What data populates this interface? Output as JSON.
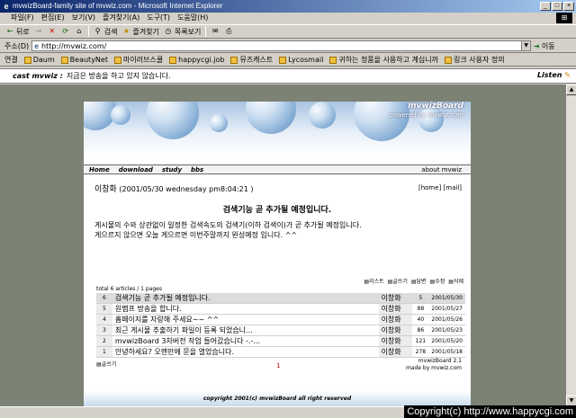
{
  "window": {
    "title": "mvwizBoard-family site of mvwiz.com - Microsoft Internet Explorer",
    "buttons": [
      "_",
      "□",
      "×"
    ]
  },
  "menu": {
    "items": [
      "파일(F)",
      "편집(E)",
      "보기(V)",
      "즐겨찾기(A)",
      "도구(T)",
      "도움말(H)"
    ]
  },
  "toolbar": {
    "back": "뒤로",
    "forward": "→",
    "stop": "✕",
    "refresh": "⟳",
    "home": "⌂",
    "search": "검색",
    "favorites": "즐겨찾기",
    "history": "목록보기",
    "mail": "✉",
    "print": "⎙"
  },
  "address": {
    "label": "주소(D)",
    "value": "http://mvwiz.com/",
    "go": "이동"
  },
  "links": {
    "label": "연결",
    "items": [
      "Daum",
      "BeautyNet",
      "마이러브스쿨",
      "happycgi.job",
      "뮤즈캐스트",
      "Lycosmail",
      "귀하는 정품을 사용하고 계십니까",
      "링크 사용자 정의"
    ]
  },
  "cast": {
    "title": "cast mvwiz :",
    "message": "지금은 방송을 하고 있지 않습니다.",
    "listen": "Listen"
  },
  "banner": {
    "title": "mvwizBoard",
    "subtitle": "powered by mvwiz.com"
  },
  "nav": {
    "items": [
      "Home",
      "download",
      "study",
      "bbs"
    ],
    "about": "about mvwiz"
  },
  "post": {
    "author": "이창화",
    "date": "(2001/05/30 wednesday pm8:04:21 )",
    "home_link": "[home]",
    "mail_link": "[mail]",
    "title": "검색기능 곧 추가될 예정입니다.",
    "body_line1": "게시물의 수와 상관없이 일정한 검색속도의 검색기(이하 검색이)가 곧 추가될 예정입니다.",
    "body_line2": "게으르지 않으면 오늘 게으르면 이번주말까지 완성예정 입니다. ^^"
  },
  "list": {
    "toolbar": [
      "리스트",
      "글쓰기",
      "답변",
      "수정",
      "삭제"
    ],
    "total": "total 6 articles / 1 pages",
    "rows": [
      {
        "num": "6",
        "subject": "검색기능 곧 추가될 예정입니다.",
        "author": "이창화",
        "hits": "5",
        "date": "2001/05/30"
      },
      {
        "num": "5",
        "subject": "원맵프 방송을 합니다.",
        "author": "이창화",
        "hits": "88",
        "date": "2001/05/27"
      },
      {
        "num": "4",
        "subject": "홈페이지를 자랑해 주세요~~ ^^",
        "author": "이창화",
        "hits": "40",
        "date": "2001/05/26"
      },
      {
        "num": "3",
        "subject": "최근 게시물 추출하기 파일이 등록 되었습니...",
        "author": "이창화",
        "hits": "86",
        "date": "2001/05/23"
      },
      {
        "num": "2",
        "subject": "mvwizBoard 3차버전 작업 들어갔습니다 -.-...",
        "author": "이창화",
        "hits": "121",
        "date": "2001/05/20"
      },
      {
        "num": "1",
        "subject": "안녕하세요? 오랜만에 문을 열었습니다.",
        "author": "이창화",
        "hits": "278",
        "date": "2001/05/18"
      }
    ],
    "write_link": "글쓰기",
    "page": "1",
    "version_line1": "mvwizBoard 2.1",
    "version_line2": "made by mvwiz.com"
  },
  "footer": {
    "copyright": "copyright 2001(c) mvwizBoard all right reserved"
  },
  "watermark": "Copyright(c) http://www.happycgi.com"
}
